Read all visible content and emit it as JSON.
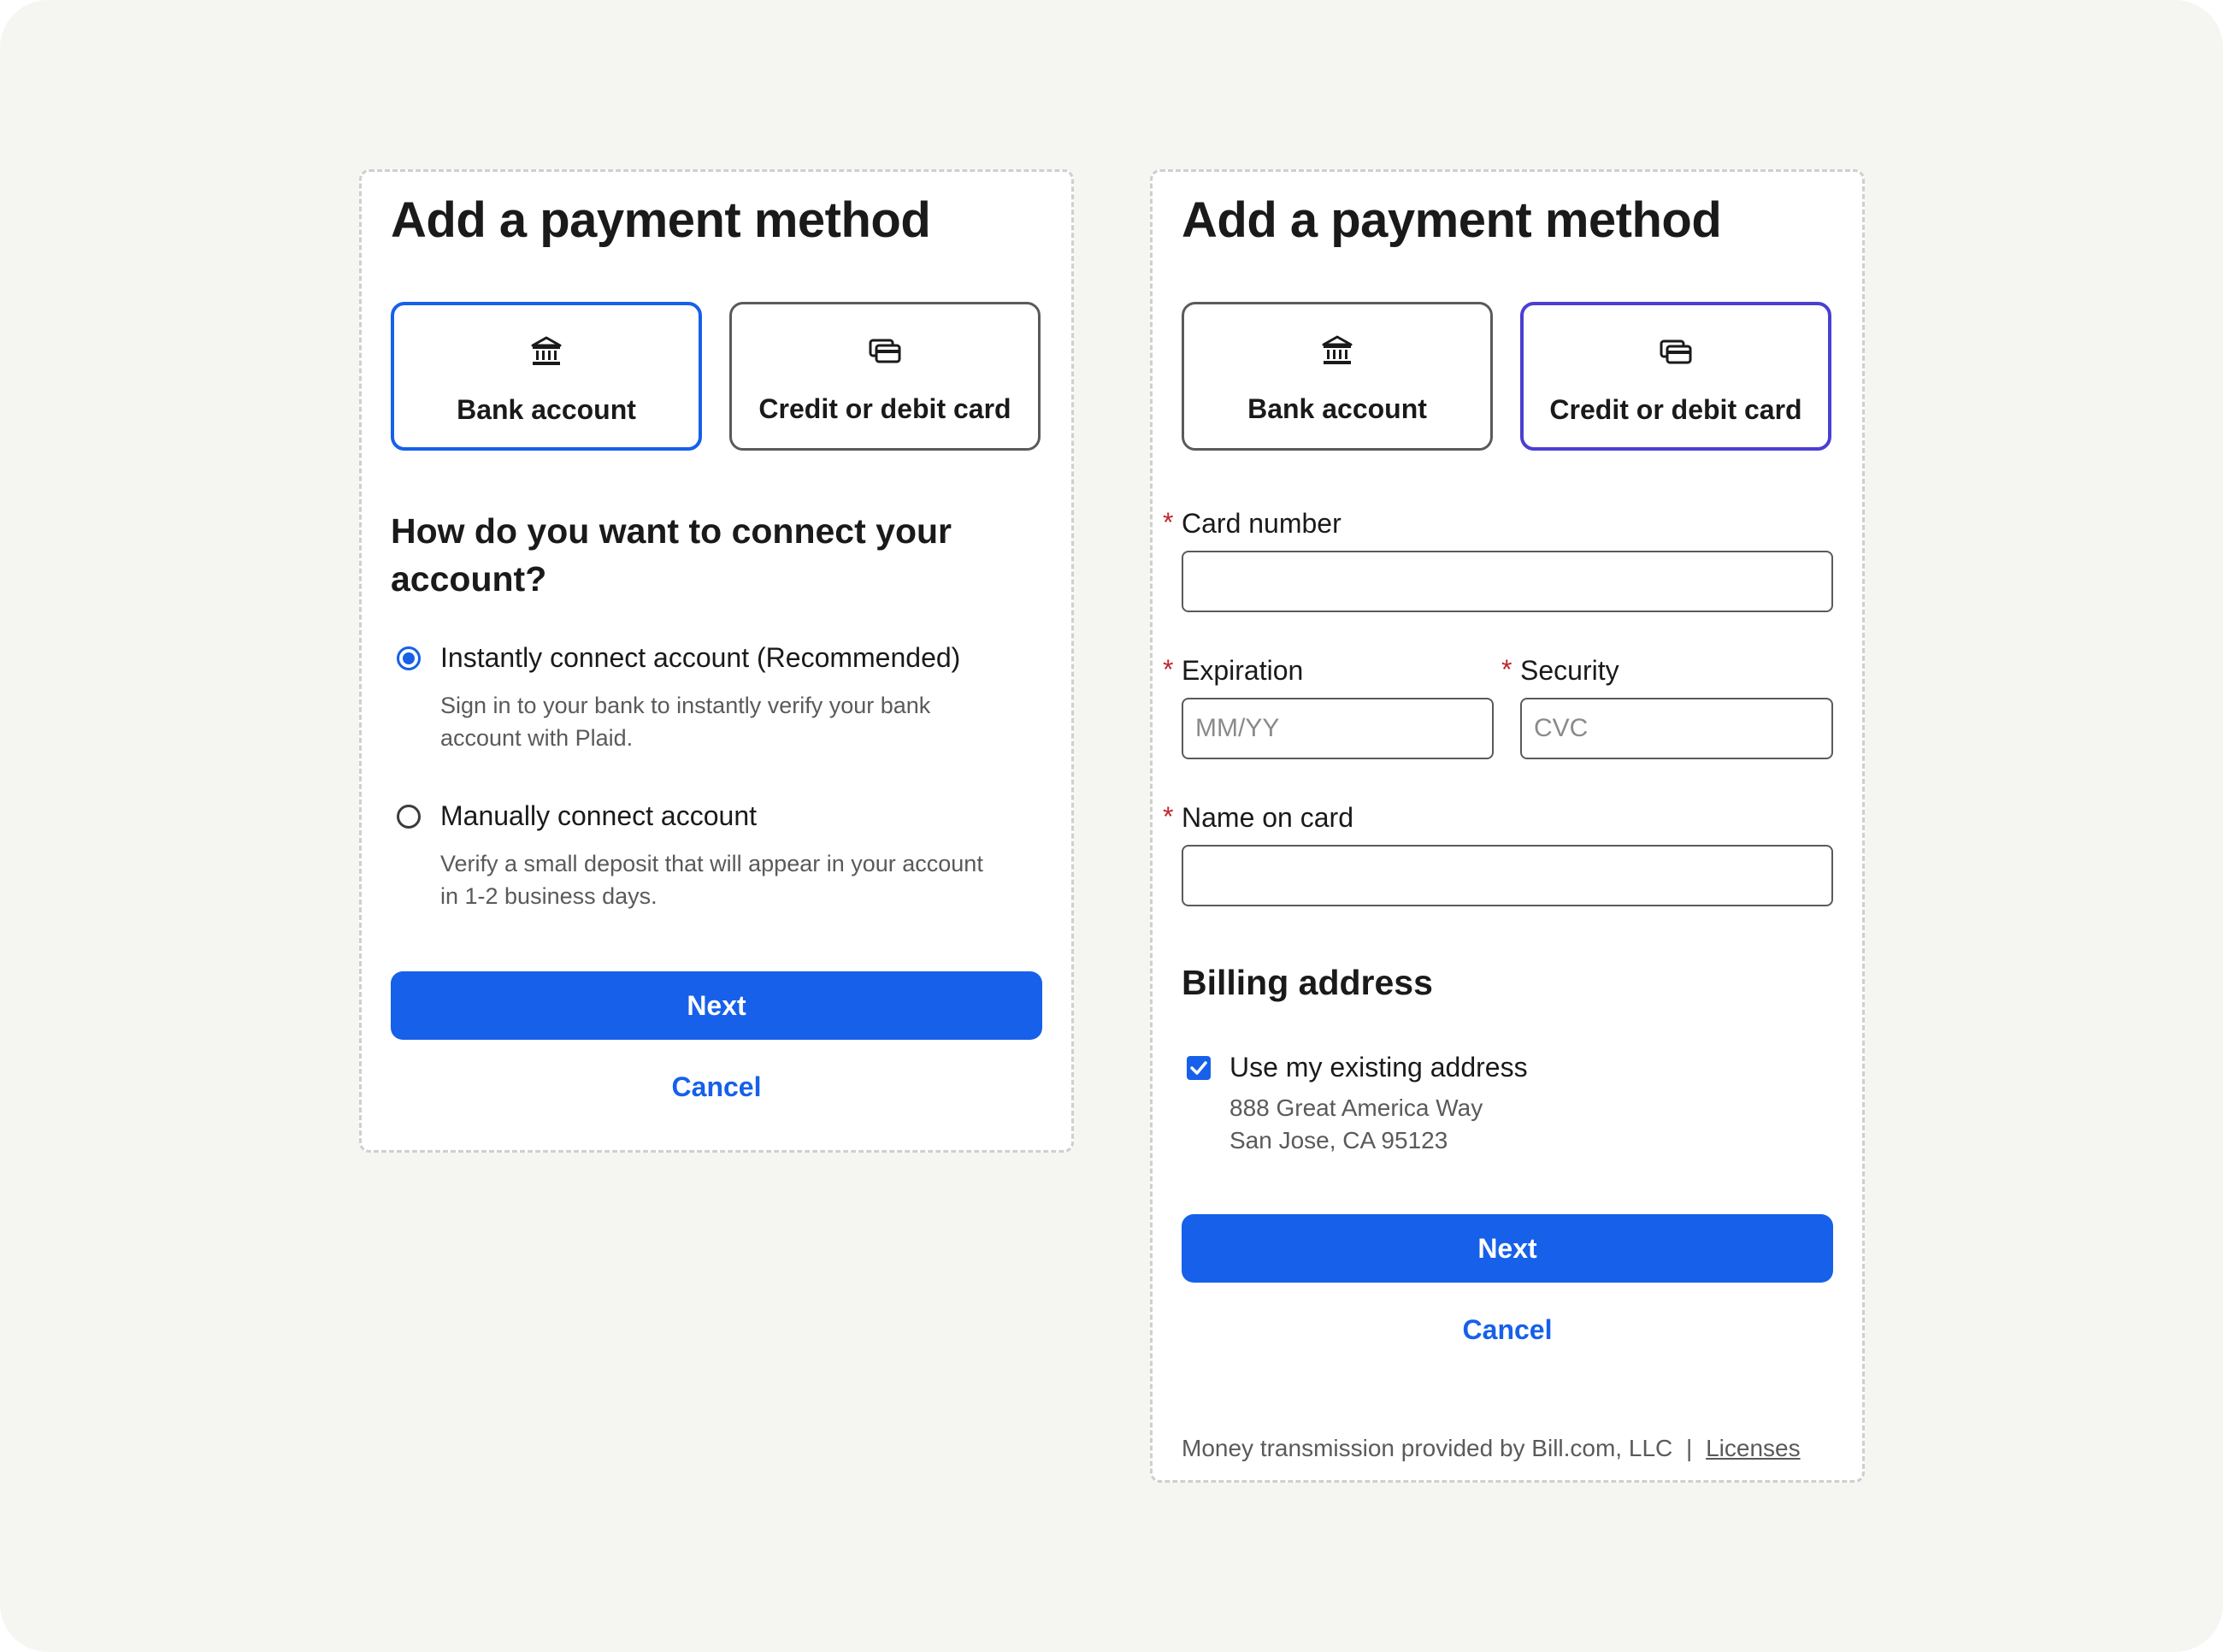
{
  "colors": {
    "primary": "#1660ea",
    "selected_card": "#4a3fd1",
    "required": "#c0262d",
    "background": "#f5f5f2"
  },
  "left": {
    "title": "Add a payment method",
    "tiles": [
      {
        "label": "Bank account",
        "icon": "bank-icon",
        "selected": true
      },
      {
        "label": "Credit or debit card",
        "icon": "credit-card-icon",
        "selected": false
      }
    ],
    "question": "How do you want to connect your account?",
    "options": [
      {
        "label": "Instantly connect account (Recommended)",
        "description": "Sign in to your bank to instantly verify your bank account with Plaid.",
        "selected": true
      },
      {
        "label": "Manually connect account",
        "description": "Verify a small deposit that will appear in your account in 1-2 business days.",
        "selected": false
      }
    ],
    "next_label": "Next",
    "cancel_label": "Cancel"
  },
  "right": {
    "title": "Add a payment method",
    "tiles": [
      {
        "label": "Bank account",
        "icon": "bank-icon",
        "selected": false
      },
      {
        "label": "Credit or debit card",
        "icon": "credit-card-icon",
        "selected": true
      }
    ],
    "required_mark": "*",
    "fields": {
      "card_number": {
        "label": "Card number",
        "value": "",
        "placeholder": ""
      },
      "expiration": {
        "label": "Expiration",
        "value": "",
        "placeholder": "MM/YY"
      },
      "security": {
        "label": "Security",
        "value": "",
        "placeholder": "CVC"
      },
      "name_on_card": {
        "label": "Name on card",
        "value": "",
        "placeholder": ""
      }
    },
    "billing": {
      "heading": "Billing address",
      "use_existing_label": "Use my existing address",
      "use_existing_checked": true,
      "address_line1": "888 Great America Way",
      "address_line2": "San Jose, CA 95123"
    },
    "next_label": "Next",
    "cancel_label": "Cancel",
    "footer": {
      "text": "Money transmission provided by Bill.com, LLC",
      "separator": "|",
      "link_label": "Licenses"
    }
  }
}
